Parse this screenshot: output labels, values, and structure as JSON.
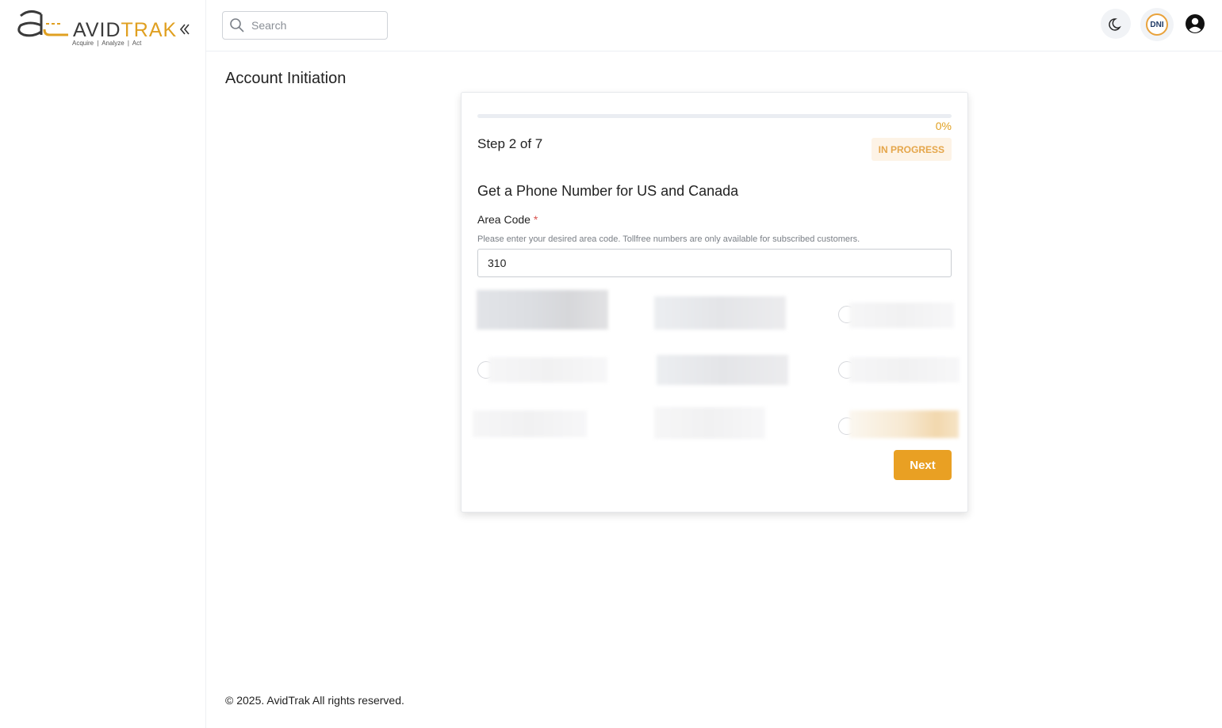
{
  "brand": {
    "logo_name_part1": "AVID",
    "logo_name_part2": "TRAK",
    "tagline": "Acquire | Analyze | Act",
    "accent_color": "#e9a023"
  },
  "header": {
    "search_placeholder": "Search",
    "dni_label": "DNI"
  },
  "page": {
    "title": "Account Initiation"
  },
  "wizard": {
    "progress_percent": 0,
    "progress_label": "0%",
    "step_label": "Step 2 of 7",
    "status": "IN PROGRESS",
    "section_title": "Get a Phone Number for US and Canada",
    "area_code_label": "Area Code",
    "required_mark": "*",
    "area_code_help": "Please enter your desired area code. Tollfree numbers are only available for subscribed customers.",
    "area_code_value": "310",
    "next_label": "Next"
  },
  "footer": {
    "copyright": "© 2025. AvidTrak All rights reserved."
  }
}
